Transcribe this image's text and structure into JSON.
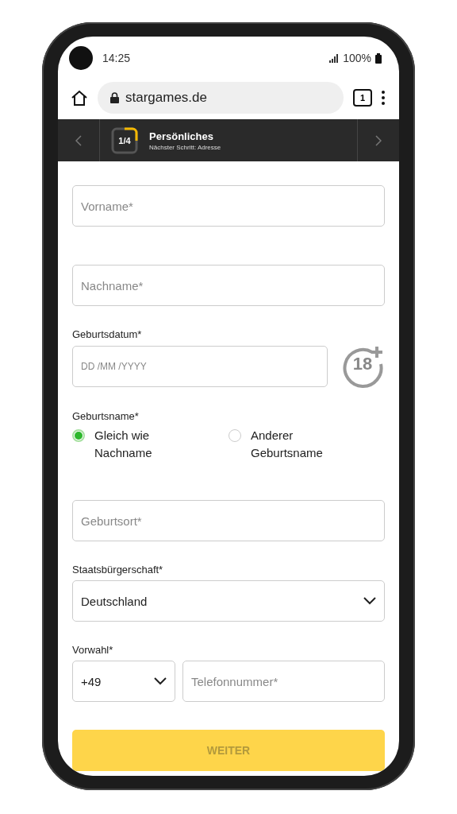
{
  "status_bar": {
    "time": "14:25",
    "battery": "100%"
  },
  "browser": {
    "url": "stargames.de",
    "tab_count": "1"
  },
  "stepper": {
    "step": "1/4",
    "title": "Persönliches",
    "subtitle": "Nächster Schritt: Adresse"
  },
  "form": [
    {
      "kind": "text",
      "placeholder": "Vorname*"
    },
    {
      "kind": "text",
      "placeholder": "Nachname*"
    },
    {
      "kind": "date",
      "label": "Geburtsdatum*",
      "placeholder": "DD /MM /YYYY",
      "badge": "18"
    },
    {
      "kind": "radio",
      "label": "Geburtsname*",
      "options": [
        {
          "label": "Gleich wie Nachname",
          "selected": true
        },
        {
          "label": "Anderer Geburtsname",
          "selected": false
        }
      ]
    },
    {
      "kind": "text",
      "placeholder": "Geburtsort*"
    },
    {
      "kind": "select",
      "label": "Staatsbürgerschaft*",
      "value": "Deutschland"
    },
    {
      "kind": "phone",
      "label": "Vorwahl*",
      "value": "+49",
      "placeholder": "Telefonnummer*"
    }
  ],
  "submit": {
    "label": "WEITER",
    "disabled": true
  }
}
